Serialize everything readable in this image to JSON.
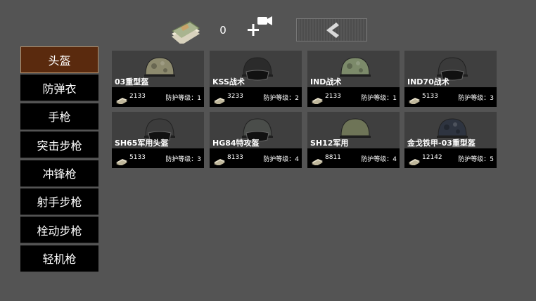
{
  "header": {
    "money": "0",
    "cash_icon": "cash-stack-icon",
    "add_icon": "add-video-icon",
    "back_icon": "chevron-left-icon"
  },
  "sidebar": {
    "items": [
      {
        "label": "头盔",
        "active": true
      },
      {
        "label": "防弹衣",
        "active": false
      },
      {
        "label": "手枪",
        "active": false
      },
      {
        "label": "突击步枪",
        "active": false
      },
      {
        "label": "冲锋枪",
        "active": false
      },
      {
        "label": "射手步枪",
        "active": false
      },
      {
        "label": "栓动步枪",
        "active": false
      },
      {
        "label": "轻机枪",
        "active": false
      }
    ]
  },
  "items": [
    {
      "name": "03重型盔",
      "price": "2133",
      "level": "防护等级：1",
      "icon": "helmet-camo-icon",
      "color": "#8d8a6e"
    },
    {
      "name": "KSS战术",
      "price": "3233",
      "level": "防护等级：2",
      "icon": "helmet-visor-icon",
      "color": "#2b2b2b"
    },
    {
      "name": "IND战术",
      "price": "2133",
      "level": "防护等级：1",
      "icon": "helmet-camo-icon",
      "color": "#7c8a6a"
    },
    {
      "name": "IND70战术",
      "price": "5133",
      "level": "防护等级：3",
      "icon": "helmet-visor-icon",
      "color": "#3a3a3a"
    },
    {
      "name": "SH65军用头盔",
      "price": "5133",
      "level": "防护等级：3",
      "icon": "helmet-visor-icon",
      "color": "#3c3c3c"
    },
    {
      "name": "HG84特攻盔",
      "price": "8133",
      "level": "防护等级：4",
      "icon": "helmet-visor-icon",
      "color": "#4a4d4a"
    },
    {
      "name": "SH12军用",
      "price": "8811",
      "level": "防护等级：4",
      "icon": "helmet-icon",
      "color": "#6e7457"
    },
    {
      "name": "金戈铁甲-03重型盔",
      "price": "12142",
      "level": "防护等级：5",
      "icon": "helmet-camo-icon",
      "color": "#2e3440"
    }
  ]
}
